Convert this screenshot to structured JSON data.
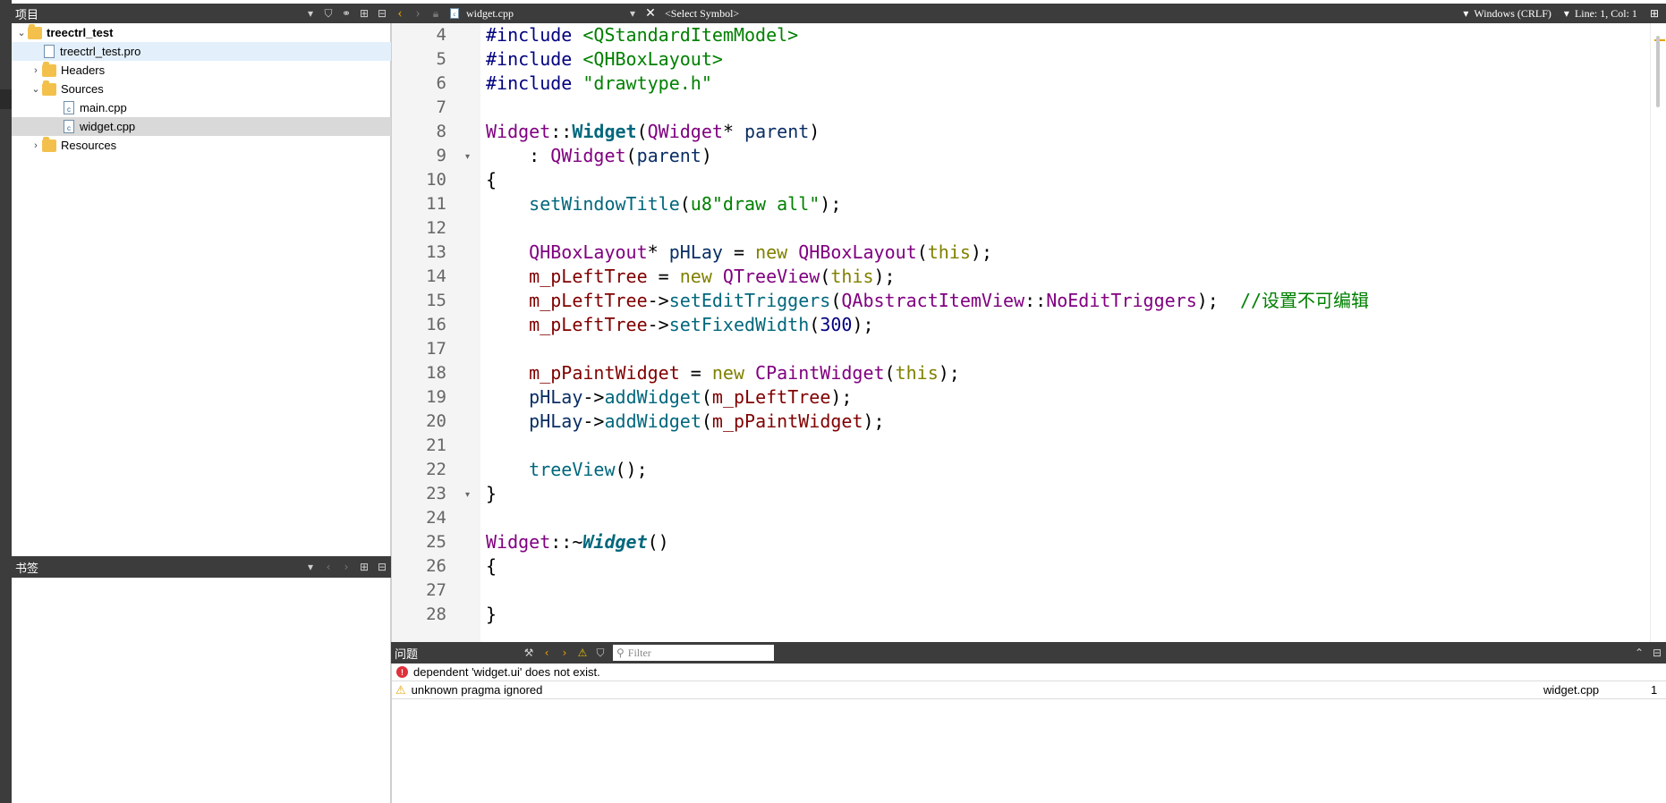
{
  "project_panel": {
    "title": "项目",
    "tree": [
      {
        "label": "treectrl_test",
        "icon": "project-folder-icon"
      },
      {
        "label": "treectrl_test.pro",
        "icon": "pro-file-icon"
      },
      {
        "label": "Headers",
        "icon": "headers-folder-icon"
      },
      {
        "label": "Sources",
        "icon": "sources-folder-icon"
      },
      {
        "label": "main.cpp",
        "icon": "cpp-file-icon"
      },
      {
        "label": "widget.cpp",
        "icon": "cpp-file-icon"
      },
      {
        "label": "Resources",
        "icon": "resources-folder-icon"
      }
    ]
  },
  "bookmarks_panel": {
    "title": "书签"
  },
  "editor_toolbar": {
    "file_name": "widget.cpp",
    "symbol_placeholder": "<Select Symbol>",
    "line_ending": "Windows (CRLF)",
    "cursor_position": "Line: 1, Col: 1"
  },
  "editor": {
    "line_numbers": [
      "4",
      "5",
      "6",
      "7",
      "8",
      "9",
      "10",
      "11",
      "12",
      "13",
      "14",
      "15",
      "16",
      "17",
      "18",
      "19",
      "20",
      "21",
      "22",
      "23",
      "24",
      "25",
      "26",
      "27",
      "28"
    ],
    "code_comment": "//设置不可编辑",
    "code_string": "u8\"draw all\"",
    "code_include3": "\"drawtype.h\"",
    "code_number": "300"
  },
  "issues_panel": {
    "title": "问题",
    "filter_placeholder": "Filter",
    "issues": [
      {
        "type": "error",
        "text": "dependent 'widget.ui' does not exist.",
        "file": "",
        "line": ""
      },
      {
        "type": "warning",
        "text": "unknown pragma ignored",
        "file": "widget.cpp",
        "line": "1"
      }
    ]
  },
  "colors": {
    "toolbar_bg": "#3c3c3c",
    "keyword": "#808000",
    "class": "#800080",
    "function": "#00677c",
    "member": "#800000",
    "comment": "#008000"
  }
}
